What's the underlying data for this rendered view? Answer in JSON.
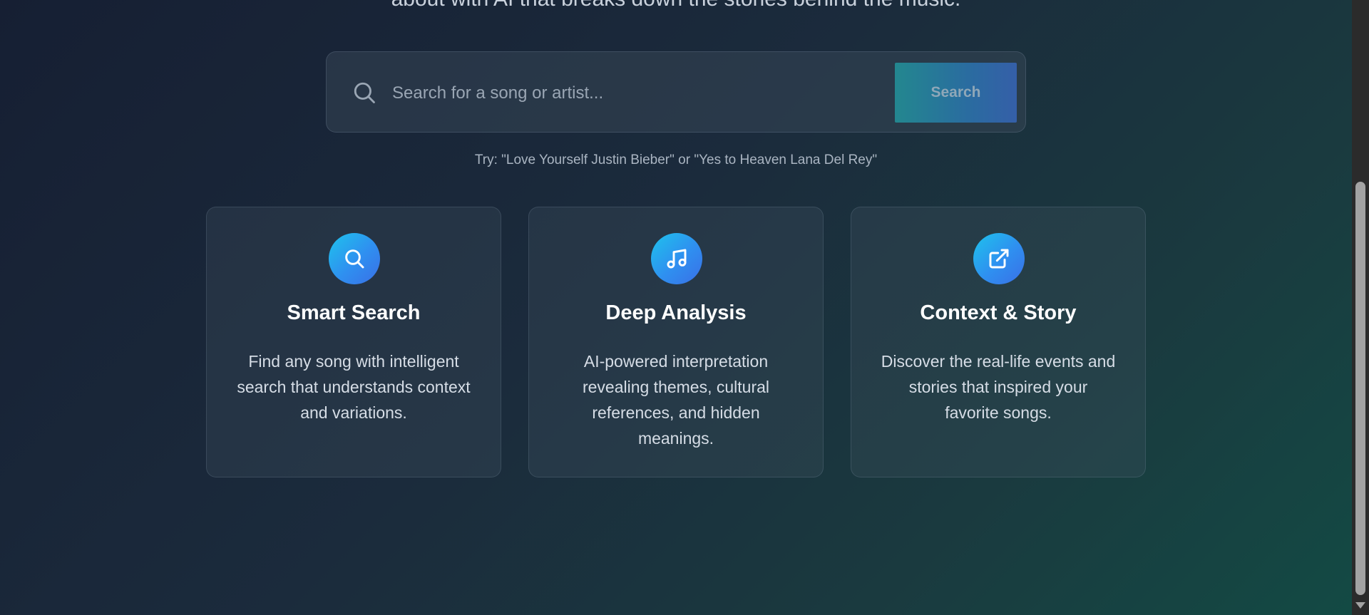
{
  "hero": {
    "tagline": "about with AI that breaks down the stories behind the music."
  },
  "search": {
    "placeholder": "Search for a song or artist...",
    "value": "",
    "button_label": "Search",
    "hint": "Try: \"Love Yourself Justin Bieber\" or \"Yes to Heaven Lana Del Rey\""
  },
  "features": [
    {
      "icon": "search-icon",
      "title": "Smart Search",
      "description": "Find any song with intelligent search that understands context and variations."
    },
    {
      "icon": "music-note-icon",
      "title": "Deep Analysis",
      "description": "AI-powered interpretation revealing themes, cultural references, and hidden meanings."
    },
    {
      "icon": "external-link-icon",
      "title": "Context & Story",
      "description": "Discover the real-life events and stories that inspired your favorite songs."
    }
  ],
  "colors": {
    "accent_gradient_start": "#1ec3ec",
    "accent_gradient_end": "#3a6fe6",
    "button_gradient_start": "#23878f",
    "button_gradient_end": "#355fa8"
  }
}
